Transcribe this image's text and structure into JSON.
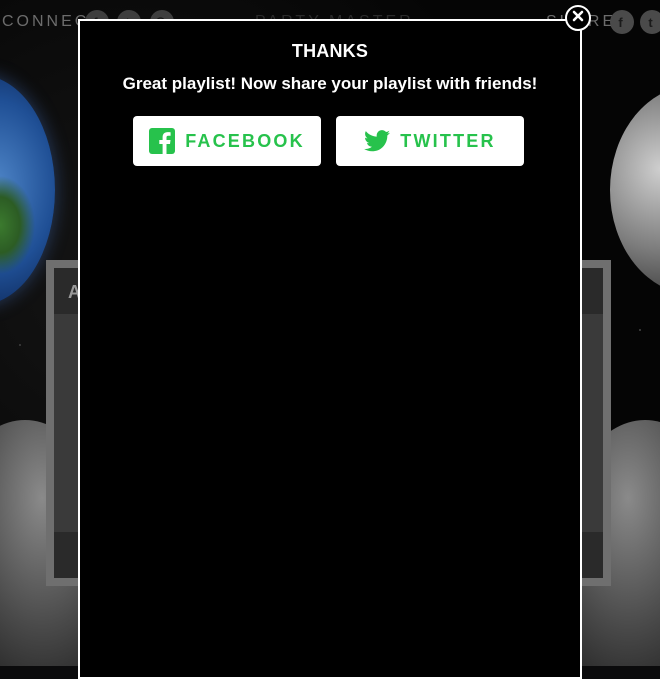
{
  "background": {
    "connect_label": "CONNECT",
    "share_label": "SHARE",
    "center_label": "PARTY MASTER",
    "panel_letter": "A",
    "social_icons": [
      "facebook-icon",
      "twitter-icon",
      "instagram-icon"
    ]
  },
  "modal": {
    "title": "THANKS",
    "message": "Great playlist! Now share your playlist with friends!",
    "facebook_label": "FACEBOOK",
    "twitter_label": "TWITTER",
    "close_icon": "close-icon"
  },
  "colors": {
    "accent_green": "#27c24c",
    "modal_bg": "#000000",
    "button_bg": "#ffffff"
  }
}
